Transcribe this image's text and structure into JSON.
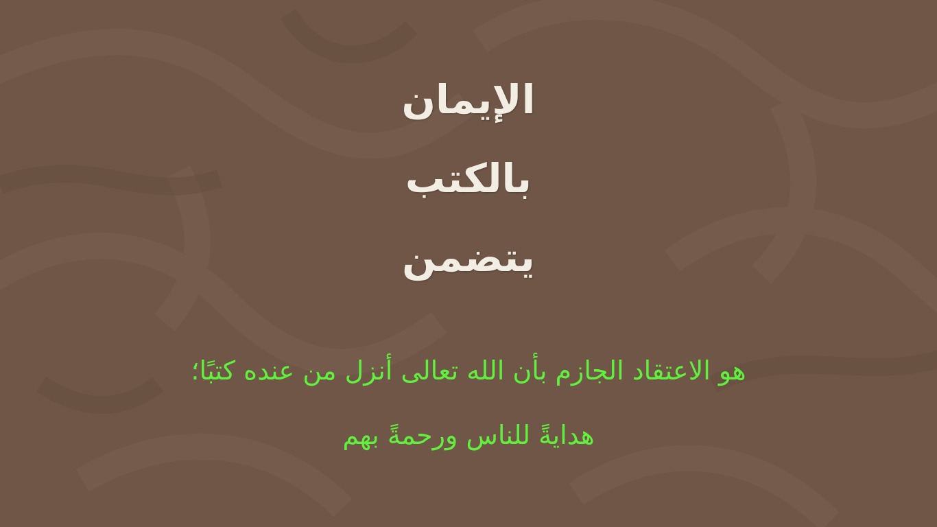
{
  "title": {
    "line1": "الإيمان",
    "line2": "بالكتب",
    "line3": "يتضمن"
  },
  "definition": {
    "line1": "هو الاعتقاد الجازم بأن الله تعالى أنزل من عنده كتبًا؛",
    "line2": "هدايةً للناس ورحمةً بهم"
  },
  "colors": {
    "background": "#6f5646",
    "title_text": "#f3eee4",
    "definition_text": "#62f03f"
  }
}
